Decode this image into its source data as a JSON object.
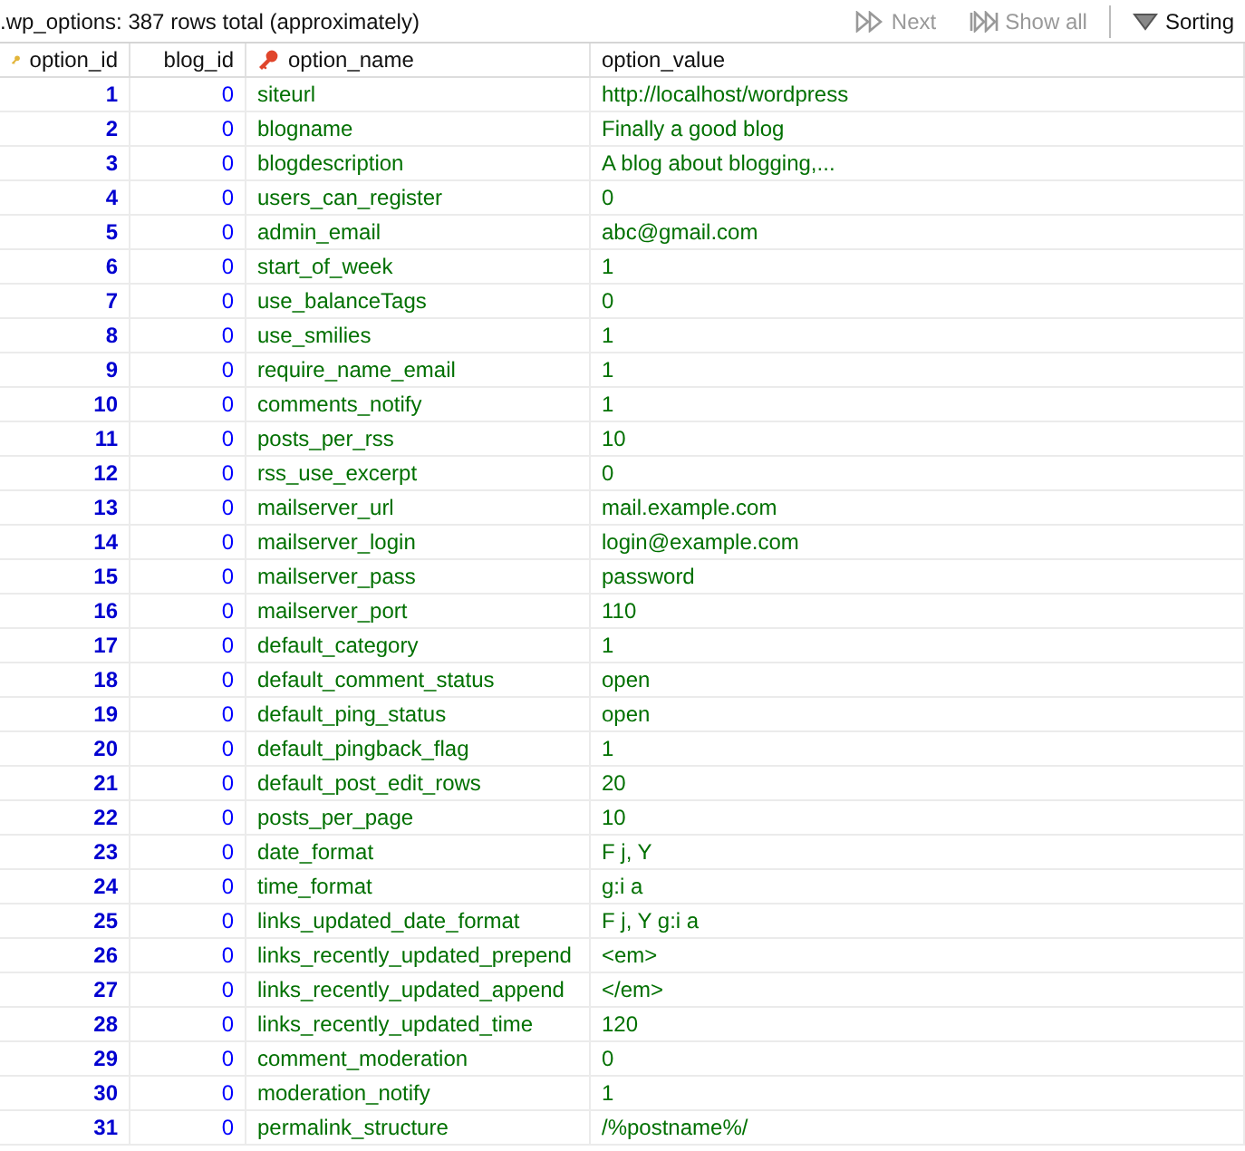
{
  "title": ".wp_options: 387 rows total (approximately)",
  "toolbar": [
    {
      "kind": "next",
      "label": "Next",
      "disabled": true
    },
    {
      "kind": "showall",
      "label": "Show all",
      "disabled": true
    },
    {
      "kind": "sorting",
      "label": "Sorting",
      "disabled": false
    }
  ],
  "table": {
    "columns": [
      {
        "label": "option_id",
        "kind": "primary"
      },
      {
        "label": "blog_id",
        "kind": "plain"
      },
      {
        "label": "option_name",
        "kind": "unique"
      },
      {
        "label": "option_value",
        "kind": "plain"
      }
    ],
    "rows": [
      [
        "1",
        "0",
        "siteurl",
        "http://localhost/wordpress"
      ],
      [
        "2",
        "0",
        "blogname",
        "Finally a good blog"
      ],
      [
        "3",
        "0",
        "blogdescription",
        "A blog about blogging,..."
      ],
      [
        "4",
        "0",
        "users_can_register",
        "0"
      ],
      [
        "5",
        "0",
        "admin_email",
        "abc@gmail.com"
      ],
      [
        "6",
        "0",
        "start_of_week",
        "1"
      ],
      [
        "7",
        "0",
        "use_balanceTags",
        "0"
      ],
      [
        "8",
        "0",
        "use_smilies",
        "1"
      ],
      [
        "9",
        "0",
        "require_name_email",
        "1"
      ],
      [
        "10",
        "0",
        "comments_notify",
        "1"
      ],
      [
        "11",
        "0",
        "posts_per_rss",
        "10"
      ],
      [
        "12",
        "0",
        "rss_use_excerpt",
        "0"
      ],
      [
        "13",
        "0",
        "mailserver_url",
        "mail.example.com"
      ],
      [
        "14",
        "0",
        "mailserver_login",
        "login@example.com"
      ],
      [
        "15",
        "0",
        "mailserver_pass",
        "password"
      ],
      [
        "16",
        "0",
        "mailserver_port",
        "110"
      ],
      [
        "17",
        "0",
        "default_category",
        "1"
      ],
      [
        "18",
        "0",
        "default_comment_status",
        "open"
      ],
      [
        "19",
        "0",
        "default_ping_status",
        "open"
      ],
      [
        "20",
        "0",
        "default_pingback_flag",
        "1"
      ],
      [
        "21",
        "0",
        "default_post_edit_rows",
        "20"
      ],
      [
        "22",
        "0",
        "posts_per_page",
        "10"
      ],
      [
        "23",
        "0",
        "date_format",
        "F j, Y"
      ],
      [
        "24",
        "0",
        "time_format",
        "g:i a"
      ],
      [
        "25",
        "0",
        "links_updated_date_format",
        "F j, Y g:i a"
      ],
      [
        "26",
        "0",
        "links_recently_updated_prepend",
        "<em>"
      ],
      [
        "27",
        "0",
        "links_recently_updated_append",
        "</em>"
      ],
      [
        "28",
        "0",
        "links_recently_updated_time",
        "120"
      ],
      [
        "29",
        "0",
        "comment_moderation",
        "0"
      ],
      [
        "30",
        "0",
        "moderation_notify",
        "1"
      ],
      [
        "31",
        "0",
        "permalink_structure",
        "/%postname%/"
      ]
    ]
  }
}
